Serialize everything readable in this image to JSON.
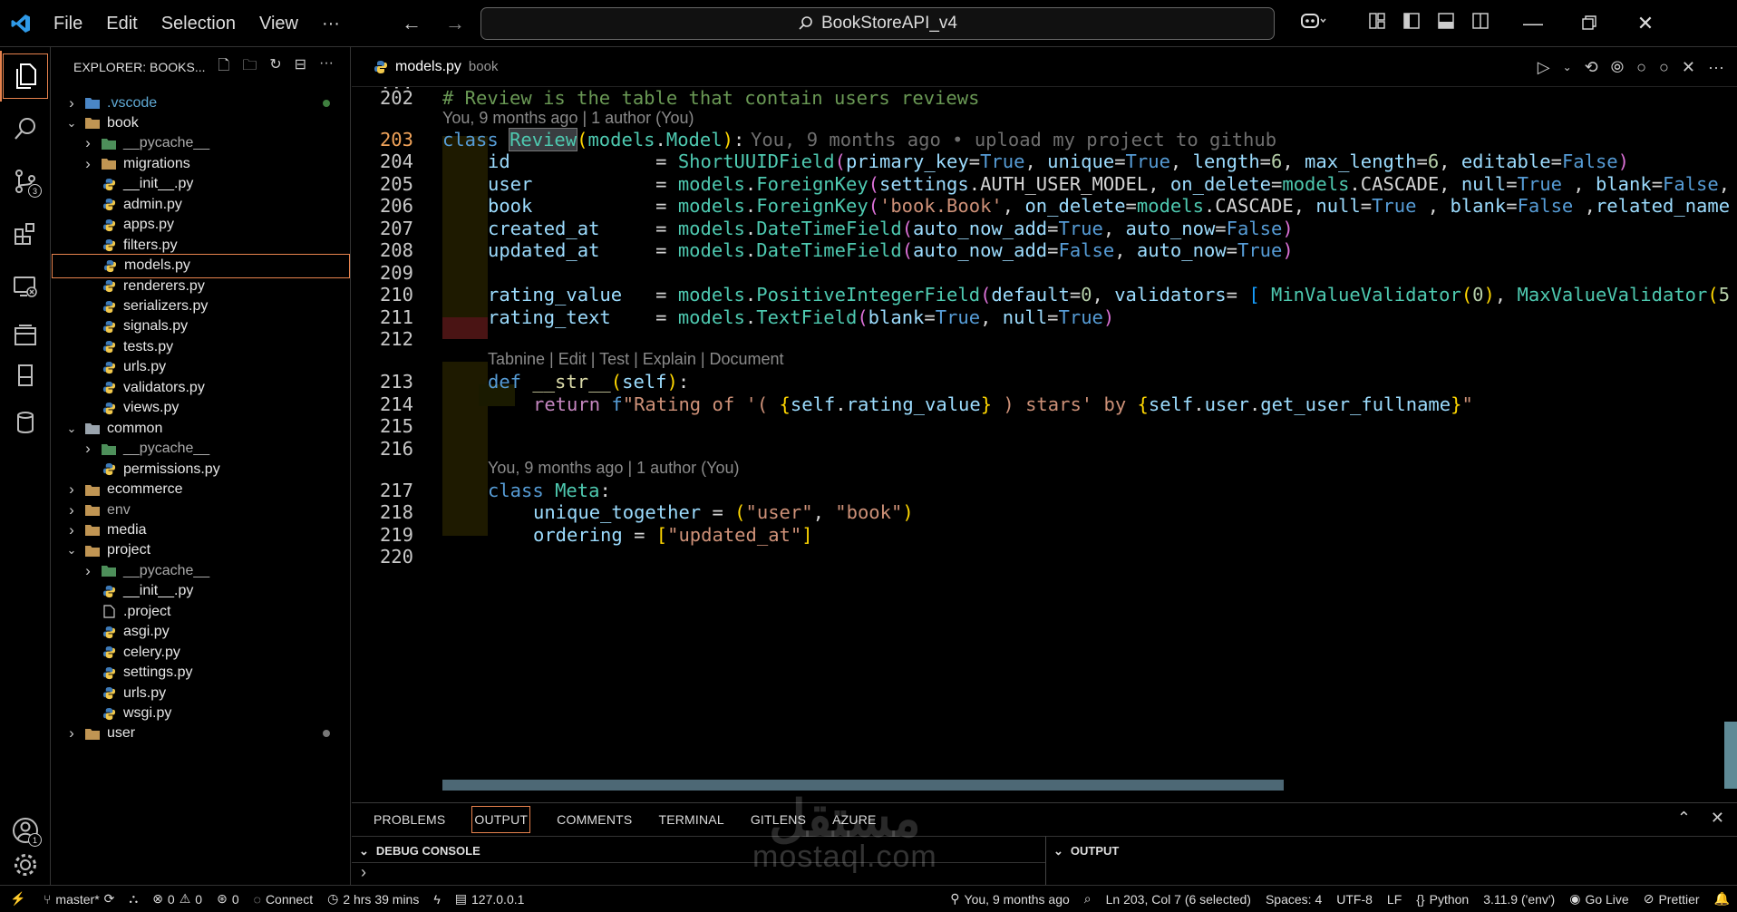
{
  "titlebar": {
    "menu": [
      "File",
      "Edit",
      "Selection",
      "View",
      "···"
    ],
    "search_text": "BookStoreAPI_v4"
  },
  "activity": {
    "source_control_badge": "3",
    "accounts_badge": "1"
  },
  "explorer": {
    "header": "EXPLORER: BOOKS...",
    "items": [
      {
        "label": ".vscode",
        "type": "folder",
        "open": false
      },
      {
        "label": "book",
        "type": "folder",
        "open": true
      },
      {
        "label": "__pycache__",
        "type": "folder",
        "open": false
      },
      {
        "label": "migrations",
        "type": "folder",
        "open": false
      },
      {
        "label": "__init__.py",
        "type": "py"
      },
      {
        "label": "admin.py",
        "type": "py"
      },
      {
        "label": "apps.py",
        "type": "py"
      },
      {
        "label": "filters.py",
        "type": "py"
      },
      {
        "label": "models.py",
        "type": "py"
      },
      {
        "label": "renderers.py",
        "type": "py"
      },
      {
        "label": "serializers.py",
        "type": "py"
      },
      {
        "label": "signals.py",
        "type": "py"
      },
      {
        "label": "tests.py",
        "type": "py"
      },
      {
        "label": "urls.py",
        "type": "py"
      },
      {
        "label": "validators.py",
        "type": "py"
      },
      {
        "label": "views.py",
        "type": "py"
      },
      {
        "label": "common",
        "type": "folder",
        "open": true
      },
      {
        "label": "__pycache__",
        "type": "folder",
        "open": false
      },
      {
        "label": "permissions.py",
        "type": "py"
      },
      {
        "label": "ecommerce",
        "type": "folder",
        "open": false
      },
      {
        "label": "env",
        "type": "folder",
        "open": false
      },
      {
        "label": "media",
        "type": "folder",
        "open": false
      },
      {
        "label": "project",
        "type": "folder",
        "open": true
      },
      {
        "label": "__pycache__",
        "type": "folder",
        "open": false
      },
      {
        "label": "__init__.py",
        "type": "py"
      },
      {
        "label": ".project",
        "type": "file"
      },
      {
        "label": "asgi.py",
        "type": "py"
      },
      {
        "label": "celery.py",
        "type": "py"
      },
      {
        "label": "settings.py",
        "type": "py"
      },
      {
        "label": "urls.py",
        "type": "py"
      },
      {
        "label": "wsgi.py",
        "type": "py"
      },
      {
        "label": "user",
        "type": "folder",
        "open": false
      }
    ]
  },
  "editor": {
    "tab_name": "models.py",
    "tab_desc": "book",
    "lens_blame_1": "You, 9 months ago | 1 author (You)",
    "inline_blame": "You, 9 months ago • upload my project to github",
    "lens_tabnine": "Tabnine | Edit | Test | Explain | Document",
    "lens_blame_2": "You, 9 months ago | 1 author (You)",
    "lines": {
      "202": "# Review is the table that contain users reviews",
      "203": "class Review(models.Model):",
      "204": "id = ShortUUIDField(primary_key=True, unique=True, length=6, max_length=6, editable=False)",
      "205": "user = models.ForeignKey(settings.AUTH_USER_MODEL, on_delete=models.CASCADE, null=True , blank=False,",
      "206": "book = models.ForeignKey('book.Book', on_delete=models.CASCADE, null=True , blank=False ,related_name",
      "207": "created_at = models.DateTimeField(auto_now_add=True, auto_now=False)",
      "208": "updated_at = models.DateTimeField(auto_now_add=False, auto_now=True)",
      "210": "rating_value = models.PositiveIntegerField(default=0, validators= [ MinValueValidator(0), MaxValueValidator(5",
      "211": "rating_text = models.TextField(blank=True, null=True)",
      "213": "def __str__(self):",
      "214": "return f\"Rating of '( {self.rating_value} ) stars' by {self.user.get_user_fullname}\"",
      "217": "class Meta:",
      "218": "unique_together = (\"user\", \"book\")",
      "219": "ordering = [\"updated_at\"]"
    },
    "line_numbers": [
      "202",
      "203",
      "204",
      "205",
      "206",
      "207",
      "208",
      "209",
      "210",
      "211",
      "212",
      "213",
      "214",
      "215",
      "216",
      "217",
      "218",
      "219",
      "220"
    ]
  },
  "panel": {
    "tabs": [
      "PROBLEMS",
      "OUTPUT",
      "COMMENTS",
      "TERMINAL",
      "GITLENS",
      "AZURE"
    ],
    "active_tab": "OUTPUT",
    "debug_console": "DEBUG CONSOLE",
    "output": "OUTPUT"
  },
  "statusbar": {
    "branch": "master*",
    "errors": "0",
    "warnings": "0",
    "ports": "0",
    "connect": "Connect",
    "time": "2 hrs 39 mins",
    "host": "127.0.0.1",
    "blame": "You, 9 months ago",
    "position": "Ln 203, Col 7 (6 selected)",
    "spaces": "Spaces: 4",
    "encoding": "UTF-8",
    "eol": "LF",
    "language": "Python",
    "interpreter": "3.11.9 ('env')",
    "golive": "Go Live",
    "prettier": "Prettier"
  },
  "watermark": {
    "arabic": "مستقل",
    "latin": "mostaql.com"
  },
  "colors": {
    "accent": "#e8834e",
    "keyword": "#569cd6",
    "class": "#4ec9b0",
    "string": "#ce9178",
    "comment": "#6a9955"
  }
}
